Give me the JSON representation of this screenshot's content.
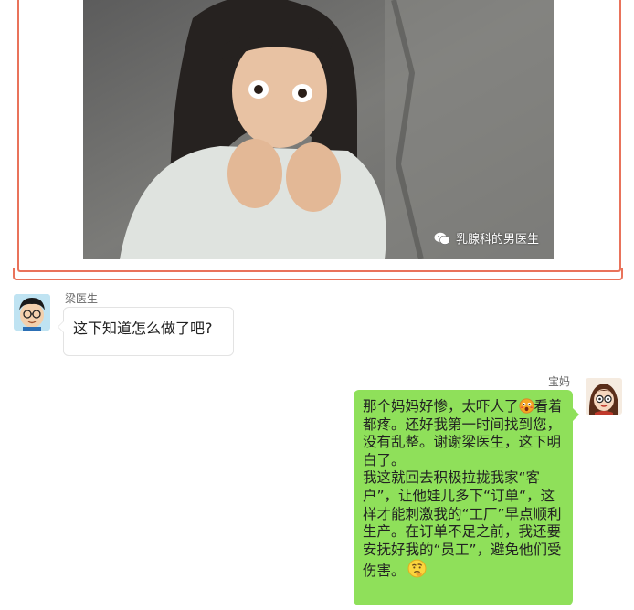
{
  "image": {
    "watermark": "乳腺科的男医生",
    "watermark_icon": "wechat-icon"
  },
  "frame_color": "#e9735b",
  "doctor": {
    "name": "梁医生",
    "avatar_icon": "doctor-avatar",
    "message": "这下知道怎么做了吧?"
  },
  "mom": {
    "name": "宝妈",
    "avatar_icon": "mom-avatar",
    "bubble_color": "#8fe05a",
    "message_p1_a": "那个妈妈好惨，太吓人了",
    "emoji_1": "frightened-emoji",
    "message_p1_b": "看着都疼。还好我第一时间找到您，没有乱整。谢谢梁医生，这下明白了。",
    "message_p2": "我这就回去积极拉拢我家“客户”，让他娃儿多下“订单“，这样才能刺激我的“工厂”早点顺利生产。在订单不足之前，我还要安抚好我的“员工”，避免他们受伤害。",
    "emoji_2": "thinking-emoji"
  }
}
